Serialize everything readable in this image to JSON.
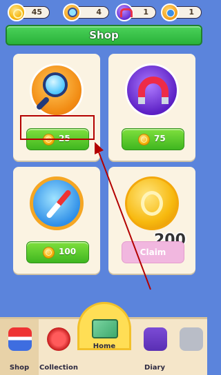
{
  "resources": [
    {
      "icon": "coin-icon",
      "value": "45"
    },
    {
      "icon": "magnifier-icon",
      "value": "4"
    },
    {
      "icon": "magnet-icon",
      "value": "1"
    },
    {
      "icon": "compass-icon",
      "value": "1"
    }
  ],
  "header": {
    "title": "Shop"
  },
  "shop_items": [
    {
      "name": "magnifier",
      "price": "25"
    },
    {
      "name": "magnet",
      "price": "75"
    },
    {
      "name": "compass",
      "price": "100"
    },
    {
      "name": "coins",
      "amount": "200",
      "action": "Claim"
    }
  ],
  "bottom_nav": [
    {
      "label": "Shop",
      "active": true
    },
    {
      "label": "Collection"
    },
    {
      "label": "Home"
    },
    {
      "label": "Diary"
    },
    {
      "label": "",
      "locked": true
    }
  ],
  "colors": {
    "background": "#5b84dc",
    "title_green": "#29b23a",
    "price_green": "#3fb620",
    "claim_pink": "#f1b7df",
    "highlight_red": "#b30000"
  }
}
